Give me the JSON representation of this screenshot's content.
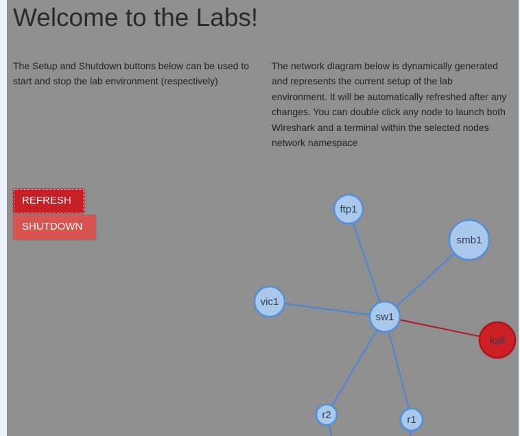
{
  "page": {
    "title": "Welcome to the Labs!",
    "left_text": "The Setup and Shutdown buttons below can be used to start and stop the lab environment (respectively)",
    "right_text": "The network diagram below is dynamically generated and represents the current setup of the lab environment. It will be automatically refreshed after any changes. You can double click any node to launch both Wireshark and a terminal within the selected nodes network namespace"
  },
  "buttons": {
    "refresh_label": "REFRESH",
    "shutdown_label": "SHUTDOWN"
  },
  "diagram": {
    "nodes": [
      {
        "id": "sw1",
        "label": "sw1",
        "status": "normal"
      },
      {
        "id": "ftp1",
        "label": "ftp1",
        "status": "normal"
      },
      {
        "id": "smb1",
        "label": "smb1",
        "status": "normal"
      },
      {
        "id": "vic1",
        "label": "vic1",
        "status": "normal"
      },
      {
        "id": "kali",
        "label": "kali",
        "status": "highlighted"
      },
      {
        "id": "r2",
        "label": "r2",
        "status": "normal"
      },
      {
        "id": "r1",
        "label": "r1",
        "status": "normal"
      }
    ],
    "links": [
      {
        "from": "sw1",
        "to": "ftp1",
        "status": "normal"
      },
      {
        "from": "sw1",
        "to": "smb1",
        "status": "normal"
      },
      {
        "from": "sw1",
        "to": "vic1",
        "status": "normal"
      },
      {
        "from": "sw1",
        "to": "kali",
        "status": "highlighted"
      },
      {
        "from": "sw1",
        "to": "r2",
        "status": "normal"
      },
      {
        "from": "sw1",
        "to": "r1",
        "status": "normal"
      }
    ]
  },
  "colors": {
    "background": "#8f8f8f",
    "node_fill": "#a9c8ec",
    "node_stroke": "#4f8fdc",
    "link": "#4a86d6",
    "highlight_fill": "#cc1f26",
    "highlight_stroke": "#a8151b",
    "highlight_link": "#b01c22",
    "refresh_button": "#c62026",
    "shutdown_button": "#d9534f"
  }
}
